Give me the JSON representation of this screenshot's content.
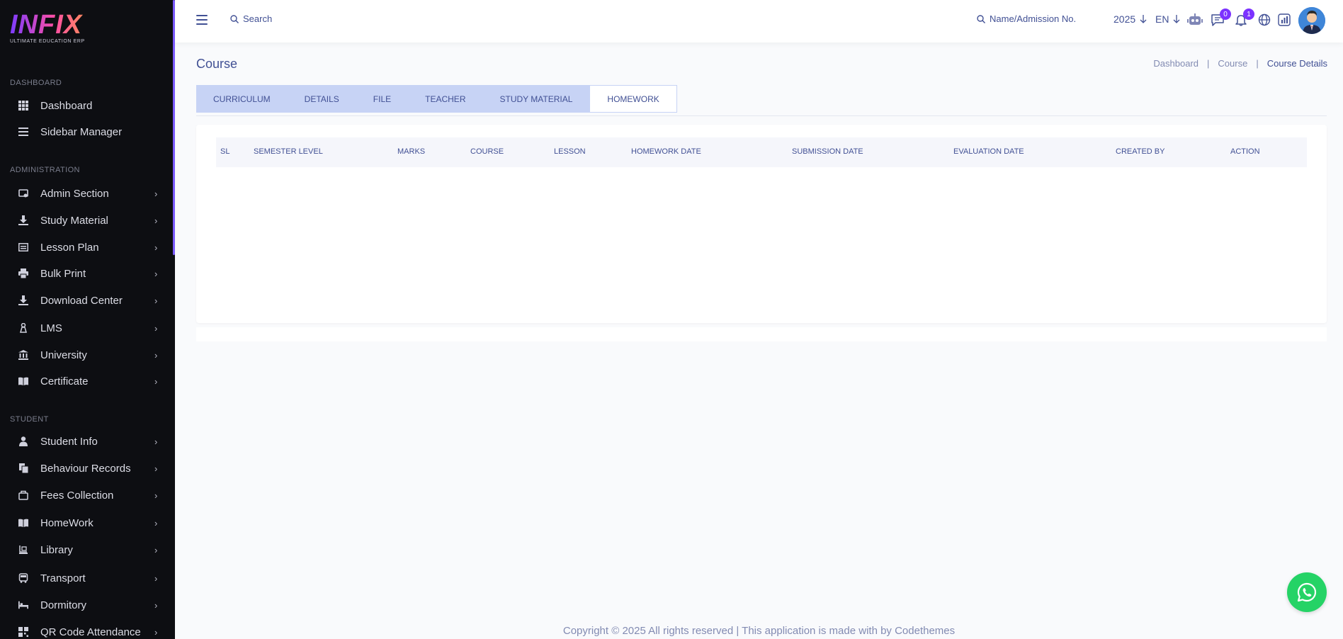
{
  "brand": {
    "logo_text": "INFIX",
    "tagline": "ULTIMATE EDUCATION ERP"
  },
  "sidebar": {
    "sections": [
      {
        "label": "DASHBOARD"
      },
      {
        "label": "ADMINISTRATION"
      },
      {
        "label": "STUDENT"
      }
    ],
    "items": [
      {
        "label": "Dashboard",
        "icon": "grid-icon"
      },
      {
        "label": "Sidebar Manager",
        "icon": "menu-lines-icon"
      },
      {
        "label": "Admin Section",
        "icon": "admin-icon"
      },
      {
        "label": "Study Material",
        "icon": "download-icon"
      },
      {
        "label": "Lesson Plan",
        "icon": "list-icon"
      },
      {
        "label": "Bulk Print",
        "icon": "printer-icon"
      },
      {
        "label": "Download Center",
        "icon": "download-icon"
      },
      {
        "label": "LMS",
        "icon": "lms-icon"
      },
      {
        "label": "University",
        "icon": "university-icon"
      },
      {
        "label": "Certificate",
        "icon": "book-icon"
      },
      {
        "label": "Student Info",
        "icon": "user-icon"
      },
      {
        "label": "Behaviour Records",
        "icon": "records-icon"
      },
      {
        "label": "Fees Collection",
        "icon": "fees-icon"
      },
      {
        "label": "HomeWork",
        "icon": "book-icon"
      },
      {
        "label": "Library",
        "icon": "library-icon"
      },
      {
        "label": "Transport",
        "icon": "bus-icon"
      },
      {
        "label": "Dormitory",
        "icon": "bed-icon"
      },
      {
        "label": "QR Code Attendance",
        "icon": "qr-icon"
      }
    ]
  },
  "header": {
    "search_placeholder": "Search",
    "admission_placeholder": "Name/Admission No.",
    "year": "2025",
    "language": "EN",
    "messages_count": "0",
    "notifications_count": "1"
  },
  "page": {
    "title": "Course",
    "breadcrumb": [
      "Dashboard",
      "Course",
      "Course Details"
    ]
  },
  "tabs": [
    "CURRICULUM",
    "DETAILS",
    "FILE",
    "TEACHER",
    "STUDY MATERIAL",
    "HOMEWORK"
  ],
  "active_tab": "HOMEWORK",
  "table": {
    "columns": [
      "SL",
      "SEMESTER LEVEL",
      "MARKS",
      "COURSE",
      "LESSON",
      "HOMEWORK DATE",
      "SUBMISSION DATE",
      "EVALUATION DATE",
      "CREATED BY",
      "ACTION"
    ],
    "rows": []
  },
  "footer": {
    "text": "Copyright © 2025 All rights reserved | This application is made with by Codethemes"
  },
  "colors": {
    "primary": "#415094",
    "accent": "#7c32ff",
    "sidebar_bg": "#0d0e12",
    "tab_bg": "#c7d3f5",
    "whatsapp": "#25d366"
  }
}
